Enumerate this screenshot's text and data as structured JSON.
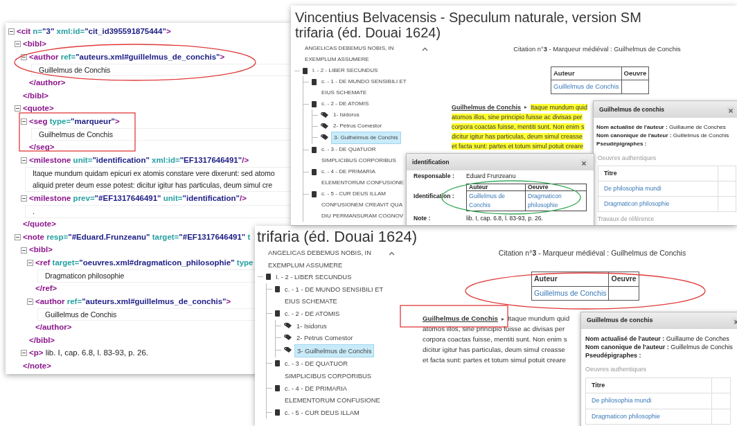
{
  "xml_panel": {
    "nodes": [
      {
        "kind": "element",
        "expanded": true,
        "parts": [
          {
            "kind": "tag",
            "text": "<cit"
          },
          {
            "kind": "attr",
            "text": " n="
          },
          {
            "kind": "value",
            "text": "\"3\""
          },
          {
            "kind": "attr",
            "text": " xml:id="
          },
          {
            "kind": "value",
            "text": "\"cit_id395591875444\""
          },
          {
            "kind": "tag",
            "text": ">"
          }
        ],
        "children": [
          {
            "kind": "element",
            "expanded": true,
            "parts": [
              {
                "kind": "tag",
                "text": "<bibl>"
              }
            ],
            "close": "</bibl>",
            "children": [
              {
                "kind": "element",
                "expanded": true,
                "parts": [
                  {
                    "kind": "tag",
                    "text": "<author"
                  },
                  {
                    "kind": "attr",
                    "text": " ref="
                  },
                  {
                    "kind": "value",
                    "text": "\"auteurs.xml#guillelmus_de_conchis\""
                  },
                  {
                    "kind": "tag",
                    "text": ">"
                  }
                ],
                "close": "</author>",
                "children": [
                  {
                    "kind": "text",
                    "lines": [
                      "Guillelmus de Conchis"
                    ]
                  }
                ]
              }
            ]
          },
          {
            "kind": "element",
            "expanded": true,
            "parts": [
              {
                "kind": "tag",
                "text": "<quote>"
              }
            ],
            "close": "</quote>",
            "children": [
              {
                "kind": "element",
                "expanded": true,
                "parts": [
                  {
                    "kind": "tag",
                    "text": "<seg"
                  },
                  {
                    "kind": "attr",
                    "text": " type="
                  },
                  {
                    "kind": "value",
                    "text": "\"marqueur\""
                  },
                  {
                    "kind": "tag",
                    "text": ">"
                  }
                ],
                "close": "</seg>",
                "children": [
                  {
                    "kind": "text",
                    "lines": [
                      "Guilhelmus de Conchis"
                    ]
                  }
                ]
              },
              {
                "kind": "element",
                "expanded": true,
                "parts": [
                  {
                    "kind": "tag",
                    "text": "<milestone"
                  },
                  {
                    "kind": "attr",
                    "text": " unit="
                  },
                  {
                    "kind": "value",
                    "text": "\"identification\""
                  },
                  {
                    "kind": "attr",
                    "text": " xml:id="
                  },
                  {
                    "kind": "value",
                    "text": "\"EF1317646491\""
                  },
                  {
                    "kind": "tag",
                    "text": "/>"
                  }
                ]
              },
              {
                "kind": "text",
                "lines": [
                  "Itaque mundum quidam epicuri ex atomis constare vere dixerunt: sed atomo",
                  "aliquid preter deum esse potest: dicitur igitur has particulas, deum simul cre"
                ]
              },
              {
                "kind": "element",
                "expanded": true,
                "parts": [
                  {
                    "kind": "tag",
                    "text": "<milestone"
                  },
                  {
                    "kind": "attr",
                    "text": " prev="
                  },
                  {
                    "kind": "value",
                    "text": "\"#EF1317646491\""
                  },
                  {
                    "kind": "attr",
                    "text": " unit="
                  },
                  {
                    "kind": "value",
                    "text": "\"identification\""
                  },
                  {
                    "kind": "tag",
                    "text": "/>"
                  }
                ]
              },
              {
                "kind": "text",
                "lines": [
                  "."
                ]
              }
            ]
          },
          {
            "kind": "element",
            "expanded": true,
            "parts": [
              {
                "kind": "tag",
                "text": "<note"
              },
              {
                "kind": "attr",
                "text": " resp="
              },
              {
                "kind": "value",
                "text": "\"#Eduard.Frunzeanu\""
              },
              {
                "kind": "attr",
                "text": " target="
              },
              {
                "kind": "value",
                "text": "\"#EF1317646491\""
              },
              {
                "kind": "attr",
                "text": " t"
              }
            ],
            "close": "</note>",
            "children": [
              {
                "kind": "element",
                "expanded": true,
                "parts": [
                  {
                    "kind": "tag",
                    "text": "<bibl>"
                  }
                ],
                "close": "</bibl>",
                "children": [
                  {
                    "kind": "element",
                    "expanded": true,
                    "parts": [
                      {
                        "kind": "tag",
                        "text": "<ref"
                      },
                      {
                        "kind": "attr",
                        "text": " target="
                      },
                      {
                        "kind": "value",
                        "text": "\"oeuvres.xml#dragmaticon_philosophie\""
                      },
                      {
                        "kind": "attr",
                        "text": " type"
                      }
                    ],
                    "close": "</ref>",
                    "children": [
                      {
                        "kind": "text",
                        "lines": [
                          "Dragmaticon philosophie"
                        ]
                      }
                    ]
                  },
                  {
                    "kind": "element",
                    "expanded": true,
                    "parts": [
                      {
                        "kind": "tag",
                        "text": "<author"
                      },
                      {
                        "kind": "attr",
                        "text": " ref="
                      },
                      {
                        "kind": "value",
                        "text": "\"auteurs.xml#guillelmus_de_conchis\""
                      },
                      {
                        "kind": "tag",
                        "text": ">"
                      }
                    ],
                    "close": "</author>",
                    "children": [
                      {
                        "kind": "text",
                        "lines": [
                          "Guillelmus de Conchis"
                        ]
                      }
                    ]
                  }
                ]
              },
              {
                "kind": "element",
                "expanded": true,
                "parts": [
                  {
                    "kind": "tag",
                    "text": "<p>"
                  },
                  {
                    "kind": "text",
                    "text": " lib. I, cap. 6.8, l. 83-93, p. 26."
                  }
                ]
              }
            ]
          }
        ]
      }
    ]
  },
  "sites": [
    {
      "title": "Vincentius Belvacensis - Speculum naturale, version SM trifaria (éd. Douai 1624)",
      "tree": [
        {
          "kind": "continuation",
          "lines": [
            "ANGELICAS DEBEMUS NOBIS, IN",
            "EXEMPLUM ASSUMERE"
          ]
        },
        {
          "kind": "section",
          "lines": [
            "I. - 2 - LIBER SECUNDUS"
          ],
          "children": [
            {
              "kind": "section",
              "lines": [
                "c. - 1 - DE MUNDO SENSIBILI ET",
                "EIUS SCHEMATE"
              ]
            },
            {
              "kind": "section",
              "lines": [
                "c. - 2 - DE ATOMIS"
              ],
              "children": [
                {
                  "kind": "citation",
                  "lines": [
                    "1- Isidorus"
                  ],
                  "selected": false
                },
                {
                  "kind": "citation",
                  "lines": [
                    "2- Petrus Comestor"
                  ],
                  "selected": false
                },
                {
                  "kind": "citation",
                  "lines": [
                    "3- Guilhelmus de Conchis"
                  ],
                  "selected": true
                }
              ]
            },
            {
              "kind": "section",
              "lines": [
                "c. - 3 - DE QUATUOR",
                "SIMPLICIBUS CORPORIBUS"
              ]
            },
            {
              "kind": "section",
              "lines": [
                "c. - 4 - DE PRIMARIA",
                "ELEMENTORUM CONFUSIONE"
              ]
            },
            {
              "kind": "section",
              "lines": [
                "c. - 5 - CUR DEUS ILLAM",
                "CONFUSIONEM CREAVIT QUA",
                "DIU PERMANSURAM COGNOV"
              ]
            }
          ]
        }
      ],
      "heading": "Citation n°**3** - Marqueur médiéval : Guilhelmus de Conchis",
      "table": {
        "columns": [
          "Auteur",
          "Oeuvre"
        ],
        "rows": [
          [
            "Guillelmus de Conchis"
          ]
        ]
      },
      "marker": "Guilhelmus de Conchis",
      "highlighted": true,
      "lines": [
        "Itaque mundum quid",
        "atomos illos, sine principio fuisse ac divisas per",
        "corpora coactas fuisse, mentiti sunt. Non enim s",
        "dicitur igitur has particulas, deum simul creasse",
        "et facta sunt: partes et totum simul potuit creare"
      ],
      "id_dialog": {
        "title": "identification",
        "fields": [
          {
            "label": "Responsable :",
            "value": "Eduard Frunzeanu"
          },
          {
            "label": "Identification :",
            "table": {
              "columns": [
                "Auteur",
                "Oeuvre"
              ],
              "rows": [
                [
                  "Guillelmus de Conchis",
                  "Dragmaticon philosophie"
                ]
              ]
            }
          },
          {
            "label": "Note :",
            "value": "lib. I, cap. 6.8, l. 83-93, p. 26."
          }
        ]
      },
      "author_popup": {
        "title": "Guilhelmus de conchis",
        "fields": [
          {
            "label": "Nom actualisé de l'auteur :",
            "value": "Guillaume de Conches"
          },
          {
            "label": "Nom canonique de l'auteur :",
            "value": "Guillelmus de Conchis"
          },
          {
            "label": "Pseudépigraphes :"
          }
        ],
        "section": "Oeuvres authentiques",
        "works": {
          "column": "Titre",
          "rows": [
            "De philosophia mundi",
            "Dragmaticon philosophie"
          ]
        },
        "footer": "Travaux de référence"
      }
    },
    {
      "title": "trifaria (éd. Douai 1624)",
      "tree": [
        {
          "kind": "continuation",
          "lines": [
            "ANGELICAS DEBEMUS NOBIS, IN",
            "EXEMPLUM ASSUMERE"
          ]
        },
        {
          "kind": "section",
          "lines": [
            "I. - 2 - LIBER SECUNDUS"
          ],
          "children": [
            {
              "kind": "section",
              "lines": [
                "c. - 1 - DE MUNDO SENSIBILI ET",
                "EIUS SCHEMATE"
              ]
            },
            {
              "kind": "section",
              "lines": [
                "c. - 2 - DE ATOMIS"
              ],
              "children": [
                {
                  "kind": "citation",
                  "lines": [
                    "1- Isidorus"
                  ],
                  "selected": false
                },
                {
                  "kind": "citation",
                  "lines": [
                    "2- Petrus Comestor"
                  ],
                  "selected": false
                },
                {
                  "kind": "citation",
                  "lines": [
                    "3- Guilhelmus de Conchis"
                  ],
                  "selected": true
                }
              ]
            },
            {
              "kind": "section",
              "lines": [
                "c. - 3 - DE QUATUOR",
                "SIMPLICIBUS CORPORIBUS"
              ]
            },
            {
              "kind": "section",
              "lines": [
                "c. - 4 - DE PRIMARIA",
                "ELEMENTORUM CONFUSIONE"
              ]
            },
            {
              "kind": "section",
              "lines": [
                "c. - 5 - CUR DEUS ILLAM"
              ]
            }
          ]
        }
      ],
      "heading": "Citation n°**3** - Marqueur médiéval : Guilhelmus de Conchis",
      "table": {
        "columns": [
          "Auteur",
          "Oeuvre"
        ],
        "rows": [
          [
            "Guillelmus de Conchis"
          ]
        ]
      },
      "marker": "Guilhelmus de Conchis",
      "highlighted": false,
      "lines": [
        "Itaque mundum quid",
        "atomos illos, sine principio fuisse ac divisas per",
        "corpora coactas fuisse, mentiti sunt. Non enim s",
        "dicitur igitur has particulas, deum simul creasse",
        "et facta sunt: partes et totum simul potuit creare"
      ],
      "author_popup": {
        "title": "Guillelmus de conchis",
        "fields": [
          {
            "label": "Nom actualisé de l'auteur :",
            "value": "Guillaume de Conches"
          },
          {
            "label": "Nom canonique de l'auteur :",
            "value": "Guillelmus de Conchis"
          },
          {
            "label": "Pseudépigraphes :"
          }
        ],
        "section": "Oeuvres authentiques",
        "works": {
          "column": "Titre",
          "rows": [
            "De philosophia mundi",
            "Dragmaticon philosophie"
          ]
        }
      }
    }
  ]
}
